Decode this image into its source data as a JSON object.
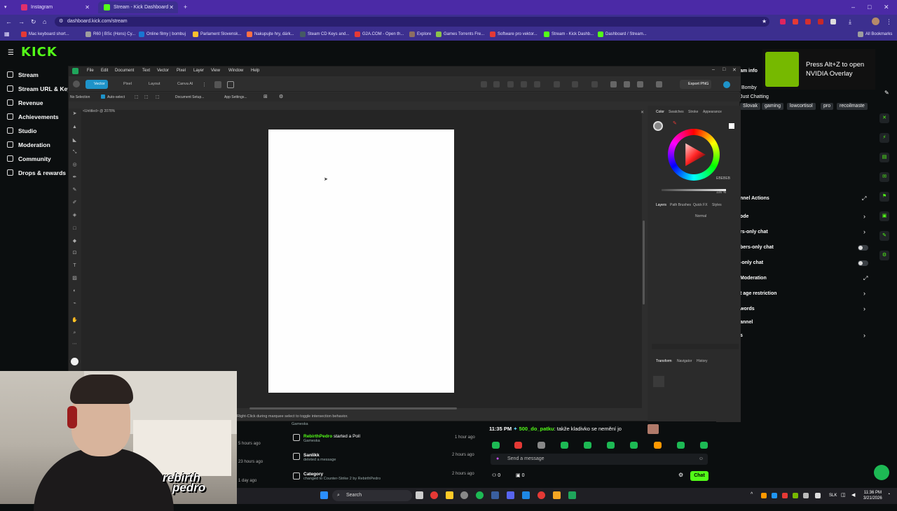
{
  "browser": {
    "tabs": [
      {
        "label": "Instagram"
      },
      {
        "label": "Stream - Kick Dashboard"
      }
    ],
    "url": "dashboard.kick.com/stream",
    "bookmarks": [
      "Mac keyboard short...",
      "R60 | BSc (Hons) Cy...",
      "Online filmy | bombuj",
      "Parlament Slovensk...",
      "Nakupujte hry, dárk...",
      "Steam CD Keys and...",
      "G2A.COM - Open th...",
      "Explore",
      "Games Torrents Fre...",
      "Software pro vektor...",
      "Stream - Kick Dashb...",
      "Dashboard / Stream..."
    ],
    "all_bookmarks": "All Bookmarks"
  },
  "kick": {
    "logo": "KICK",
    "nav": [
      "Stream",
      "Stream URL & Key",
      "Revenue",
      "Achievements",
      "Studio",
      "Moderation",
      "Community",
      "Drops & rewards"
    ],
    "nvidia": {
      "line1": "Press Alt+Z to open",
      "line2": "NVIDIA Overlay"
    },
    "stream_info": {
      "title_partial": "am info",
      "name_partial": "Bomby",
      "category": "Just Chatting",
      "tags": [
        "Slovak",
        "gaming",
        "lowcortisol",
        "pro",
        "recoilmaste"
      ]
    },
    "channel_actions": {
      "title": "nnel Actions",
      "items": [
        "ode",
        "rs-only chat",
        "bers-only chat",
        "-only chat",
        "Moderation",
        "t age restriction",
        "words",
        "annel",
        "s"
      ]
    },
    "feed": [
      {
        "name": "",
        "sub": "Gameska",
        "ago": "",
        "time": ""
      },
      {
        "name": "RebirthPedro",
        "action": "started a Poll",
        "sub": "Gameska",
        "ago": "5 hours ago",
        "time": "1 hour ago"
      },
      {
        "name": "Sanlikk",
        "action": "",
        "sub": "deleted a message",
        "ago": "23 hours ago",
        "time": "2 hours ago"
      },
      {
        "name": "Category",
        "action": "",
        "sub": "changed to Counter-Strike 2 by RebirthPedro",
        "ago": "1 day ago",
        "time": "2 hours ago"
      }
    ],
    "chat": {
      "time": "11:35 PM",
      "user": "500_do_patku",
      "message": ": takže kladivko se nemění jo",
      "placeholder": "Send a message",
      "button": "Chat",
      "count1": "0",
      "count2": "0"
    }
  },
  "affinity": {
    "menu": [
      "File",
      "Edit",
      "Document",
      "Text",
      "Vector",
      "Pixel",
      "Layer",
      "View",
      "Window",
      "Help"
    ],
    "personas": [
      "Vector",
      "Pixel",
      "Layout",
      "Canva AI"
    ],
    "export": "Export PNG",
    "context": {
      "selection": "No Selection",
      "auto_select": "Auto-select",
      "doc_setup": "Document Setup...",
      "app_settings": "App Settings..."
    },
    "doc_tab": "<Untitled> @ 2078%",
    "panel_tabs_top": [
      "Color",
      "Swatches",
      "Stroke",
      "Appearance"
    ],
    "hex": "EBEBEB",
    "opacity": "100 %",
    "panel_tabs_mid": [
      "Layers",
      "Path Brushes",
      "Quick FX",
      "Styles"
    ],
    "blend": "Normal",
    "panel_tabs_bottom": [
      "Transform",
      "Navigator",
      "History"
    ],
    "status": "Right-Click during marquee select to toggle intersection behavior."
  },
  "overlay": {
    "brand_line1": "rebirth",
    "brand_line2": "pedro"
  },
  "taskbar": {
    "search": "Search",
    "lang": "SLK",
    "time": "11:36 PM",
    "date": "3/21/2026"
  }
}
